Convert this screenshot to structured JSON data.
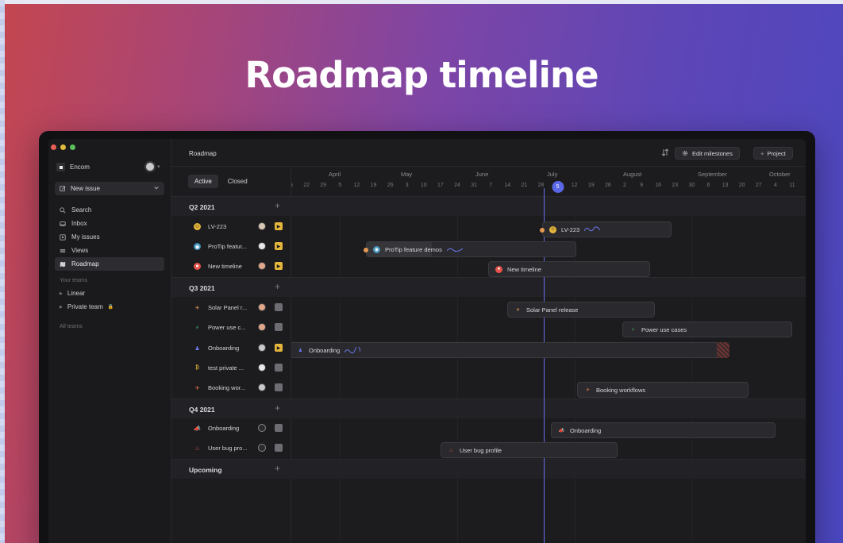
{
  "headline": "Roadmap timeline",
  "colors": {
    "accent": "#5a67e6",
    "today_line": "#6670e8",
    "bg_gradient_start": "#c4464f",
    "bg_gradient_end": "#4b47c0"
  },
  "sidebar": {
    "workspace": "Encom",
    "new_issue": "New issue",
    "nav": [
      {
        "label": "Search",
        "icon": "search-icon"
      },
      {
        "label": "Inbox",
        "icon": "inbox-icon"
      },
      {
        "label": "My issues",
        "icon": "my-issues-icon"
      },
      {
        "label": "Views",
        "icon": "views-icon"
      },
      {
        "label": "Roadmap",
        "icon": "roadmap-icon",
        "active": true
      }
    ],
    "your_teams_label": "Your teams",
    "teams": [
      "Linear",
      "Private team"
    ],
    "all_teams_label": "All teams"
  },
  "header": {
    "title": "Roadmap",
    "edit_milestones": "Edit milestones",
    "project": "Project",
    "project_prefix": "+"
  },
  "tabs": {
    "active": "Active",
    "closed": "Closed"
  },
  "groups": {
    "q2": "Q2 2021",
    "q3": "Q3 2021",
    "q4": "Q4 2021",
    "upcoming": "Upcoming"
  },
  "projects": {
    "lv223": {
      "name": "LV-223",
      "bar": "LV-223"
    },
    "protip": {
      "name": "ProTip featur...",
      "bar": "ProTip feature demos"
    },
    "newtimeline": {
      "name": "New timeline",
      "bar": "New timeline"
    },
    "solar": {
      "name": "Solar Panel r...",
      "bar": "Solar Panel release"
    },
    "power": {
      "name": "Power use c...",
      "bar": "Power use cases"
    },
    "onboarding3": {
      "name": "Onboarding",
      "bar": "Onboarding"
    },
    "testprivate": {
      "name": "test private ..."
    },
    "booking": {
      "name": "Booking wor...",
      "bar": "Booking workflows"
    },
    "onboarding4": {
      "name": "Onboarding",
      "bar": "Onboarding"
    },
    "userbug": {
      "name": "User bug pro...",
      "bar": "User bug profile"
    }
  },
  "timeline": {
    "months": [
      "April",
      "May",
      "June",
      "July",
      "August",
      "September",
      "October"
    ],
    "days": [
      "15",
      "22",
      "29",
      "5",
      "12",
      "19",
      "26",
      "3",
      "10",
      "17",
      "24",
      "31",
      "7",
      "14",
      "21",
      "28",
      "5",
      "12",
      "19",
      "26",
      "2",
      "9",
      "16",
      "23",
      "30",
      "6",
      "13",
      "20",
      "27",
      "4",
      "11"
    ],
    "today": "29"
  }
}
